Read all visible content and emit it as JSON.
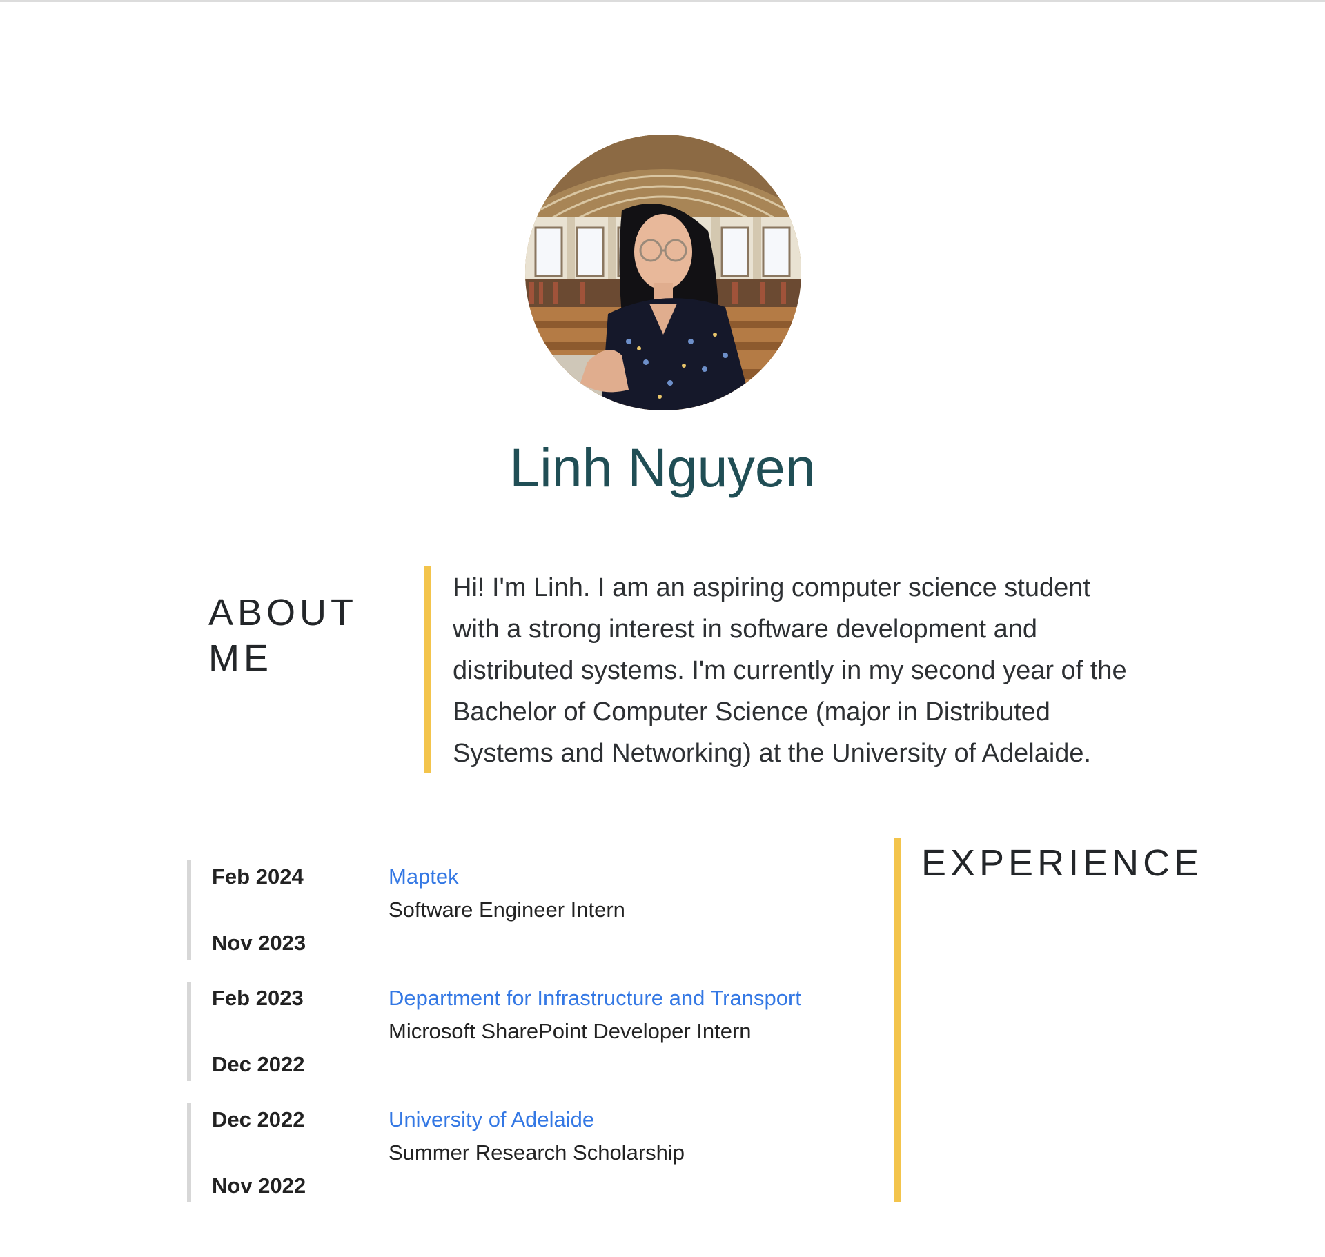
{
  "profile": {
    "name": "Linh Nguyen"
  },
  "about": {
    "heading": "ABOUT ME",
    "text": "Hi! I'm Linh. I am an aspiring computer science student with a strong interest in software development and distributed systems. I'm currently in my second year of the Bachelor of Computer Science (major in Distributed Systems and Networking) at the University of Adelaide."
  },
  "experience": {
    "heading": "EXPERIENCE",
    "items": [
      {
        "end": "Feb 2024",
        "start": "Nov 2023",
        "company": "Maptek",
        "role": "Software Engineer Intern"
      },
      {
        "end": "Feb 2023",
        "start": "Dec 2022",
        "company": "Department for Infrastructure and Transport",
        "role": "Microsoft SharePoint Developer Intern"
      },
      {
        "end": "Dec 2022",
        "start": "Nov 2022",
        "company": "University of Adelaide",
        "role": "Summer Research Scholarship"
      }
    ]
  },
  "colors": {
    "accent": "#f3c44c",
    "name": "#204e55",
    "link": "#3478e4",
    "timeline": "#d7d7d7"
  }
}
